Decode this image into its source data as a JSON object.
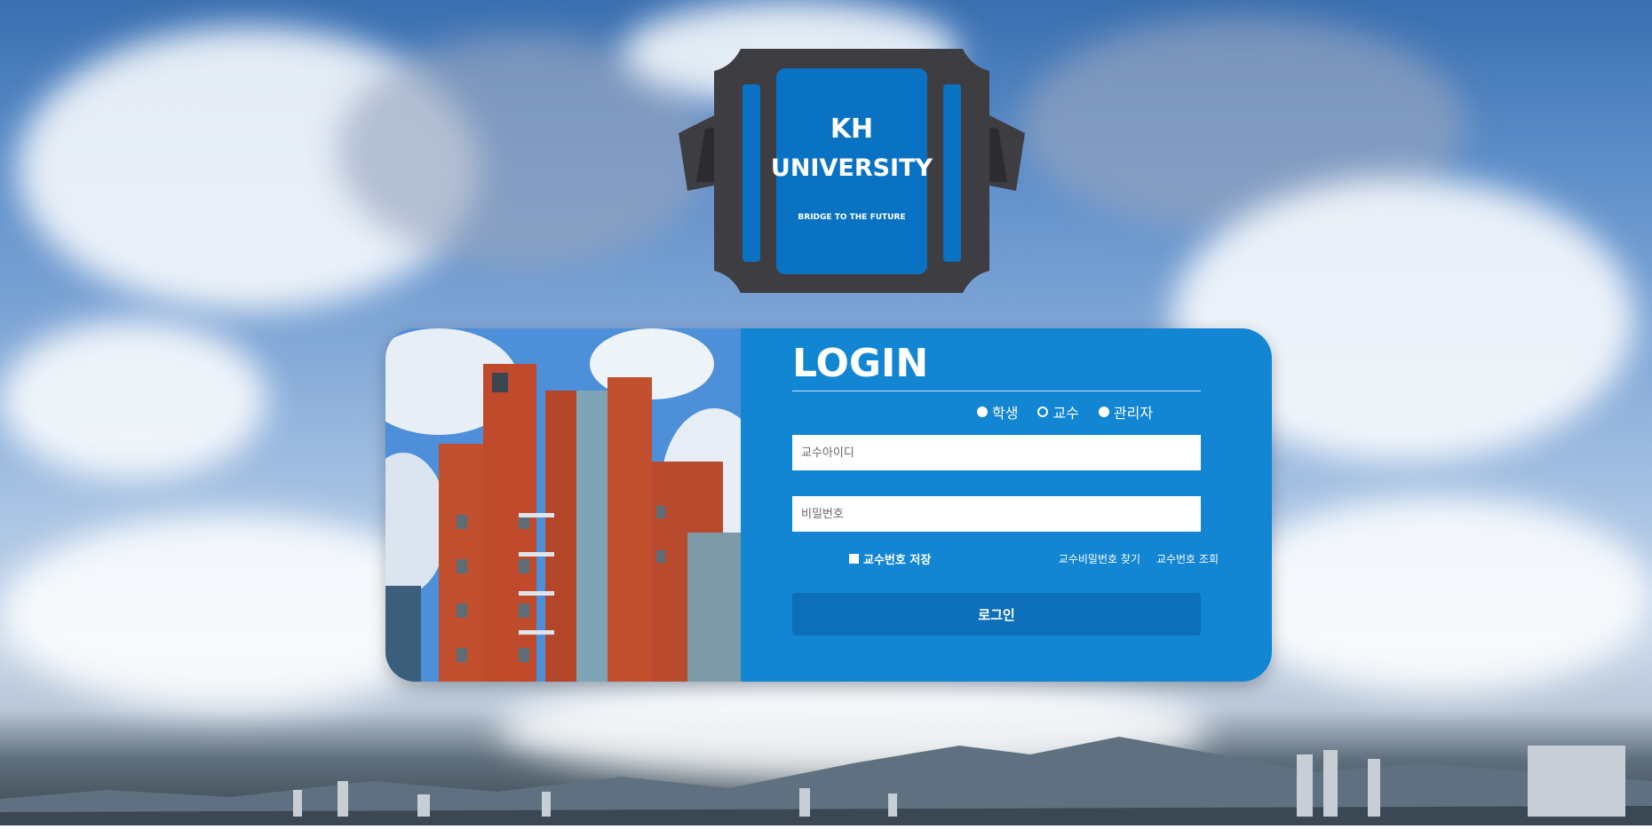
{
  "logo": {
    "line1": "KH",
    "line2": "UNIVERSITY",
    "tagline": "BRIDGE TO THE FUTURE"
  },
  "login": {
    "title": "LOGIN",
    "roles": [
      {
        "label": "학생",
        "selected": false
      },
      {
        "label": "교수",
        "selected": true
      },
      {
        "label": "관리자",
        "selected": false
      }
    ],
    "id_placeholder": "교수아이디",
    "password_placeholder": "비밀번호",
    "save_label": "교수번호 저장",
    "find_password_link": "교수비밀번호 찾기",
    "lookup_id_link": "교수번호 조회",
    "submit_label": "로그인"
  },
  "colors": {
    "panel": "#1285d3",
    "button": "#0d6eba",
    "logo_blue": "#0a72c3",
    "logo_frame": "#3e3e42"
  }
}
